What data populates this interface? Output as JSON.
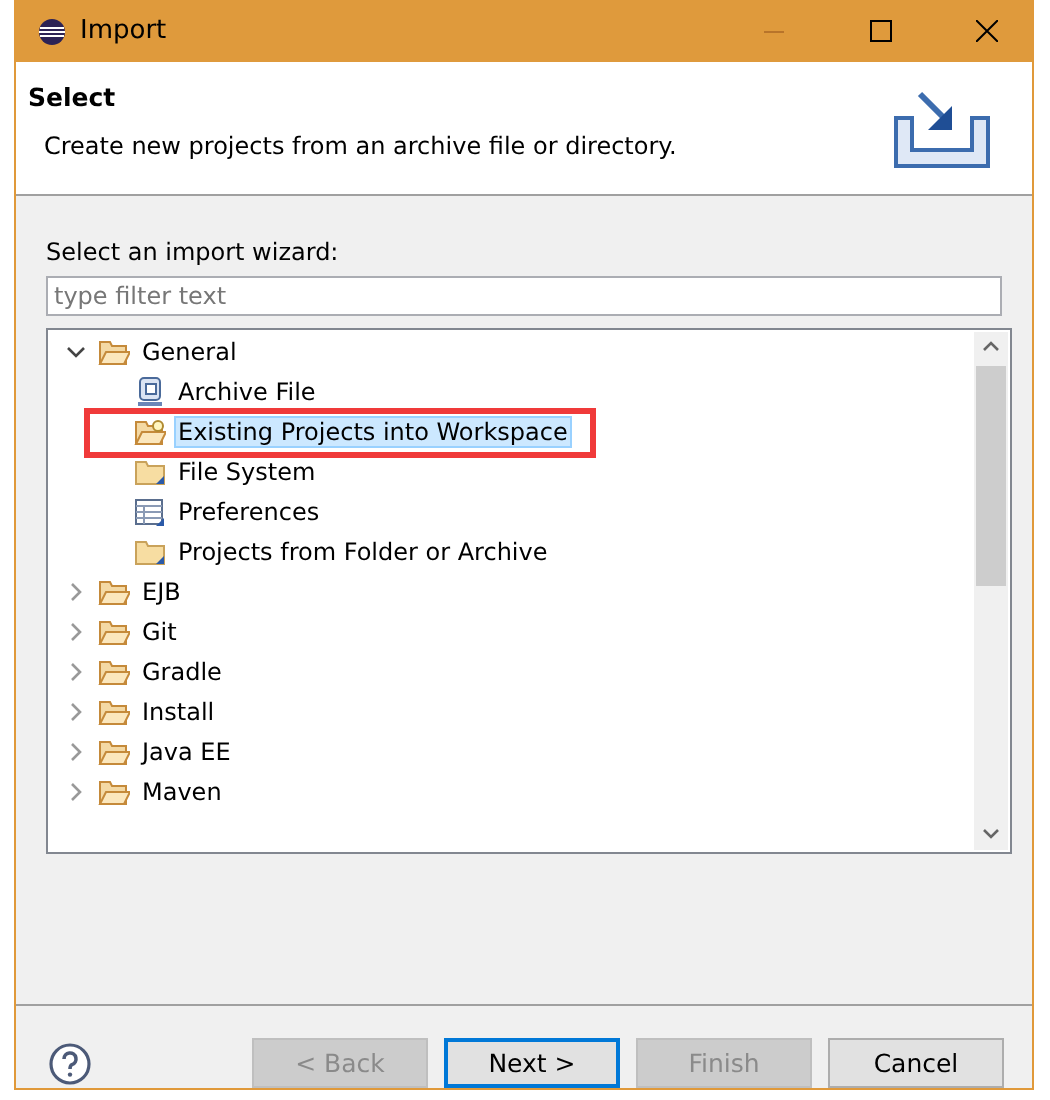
{
  "window": {
    "title": "Import"
  },
  "header": {
    "title": "Select",
    "description": "Create new projects from an archive file or directory."
  },
  "wizard_label": "Select an import wizard:",
  "filter": {
    "placeholder": "type filter text"
  },
  "tree": [
    {
      "label": "General",
      "kind": "folder",
      "expanded": true,
      "selected": false,
      "children": [
        {
          "label": "Archive File",
          "kind": "archive",
          "selected": false,
          "marked": false
        },
        {
          "label": "Existing Projects into Workspace",
          "kind": "project-folder",
          "selected": true,
          "marked": true
        },
        {
          "label": "File System",
          "kind": "shortcut-folder",
          "selected": false,
          "marked": false
        },
        {
          "label": "Preferences",
          "kind": "table",
          "selected": false,
          "marked": false
        },
        {
          "label": "Projects from Folder or Archive",
          "kind": "shortcut-folder",
          "selected": false,
          "marked": false
        }
      ]
    },
    {
      "label": "EJB",
      "kind": "folder",
      "expanded": false,
      "selected": false
    },
    {
      "label": "Git",
      "kind": "folder",
      "expanded": false,
      "selected": false
    },
    {
      "label": "Gradle",
      "kind": "folder",
      "expanded": false,
      "selected": false
    },
    {
      "label": "Install",
      "kind": "folder",
      "expanded": false,
      "selected": false
    },
    {
      "label": "Java EE",
      "kind": "folder",
      "expanded": false,
      "selected": false
    },
    {
      "label": "Maven",
      "kind": "folder",
      "expanded": false,
      "selected": false
    }
  ],
  "buttons": [
    {
      "label": "< Back",
      "disabled": true,
      "default": false
    },
    {
      "label": "Next >",
      "disabled": false,
      "default": true
    },
    {
      "label": "Finish",
      "disabled": true,
      "default": false
    },
    {
      "label": "Cancel",
      "disabled": false,
      "default": false
    }
  ]
}
